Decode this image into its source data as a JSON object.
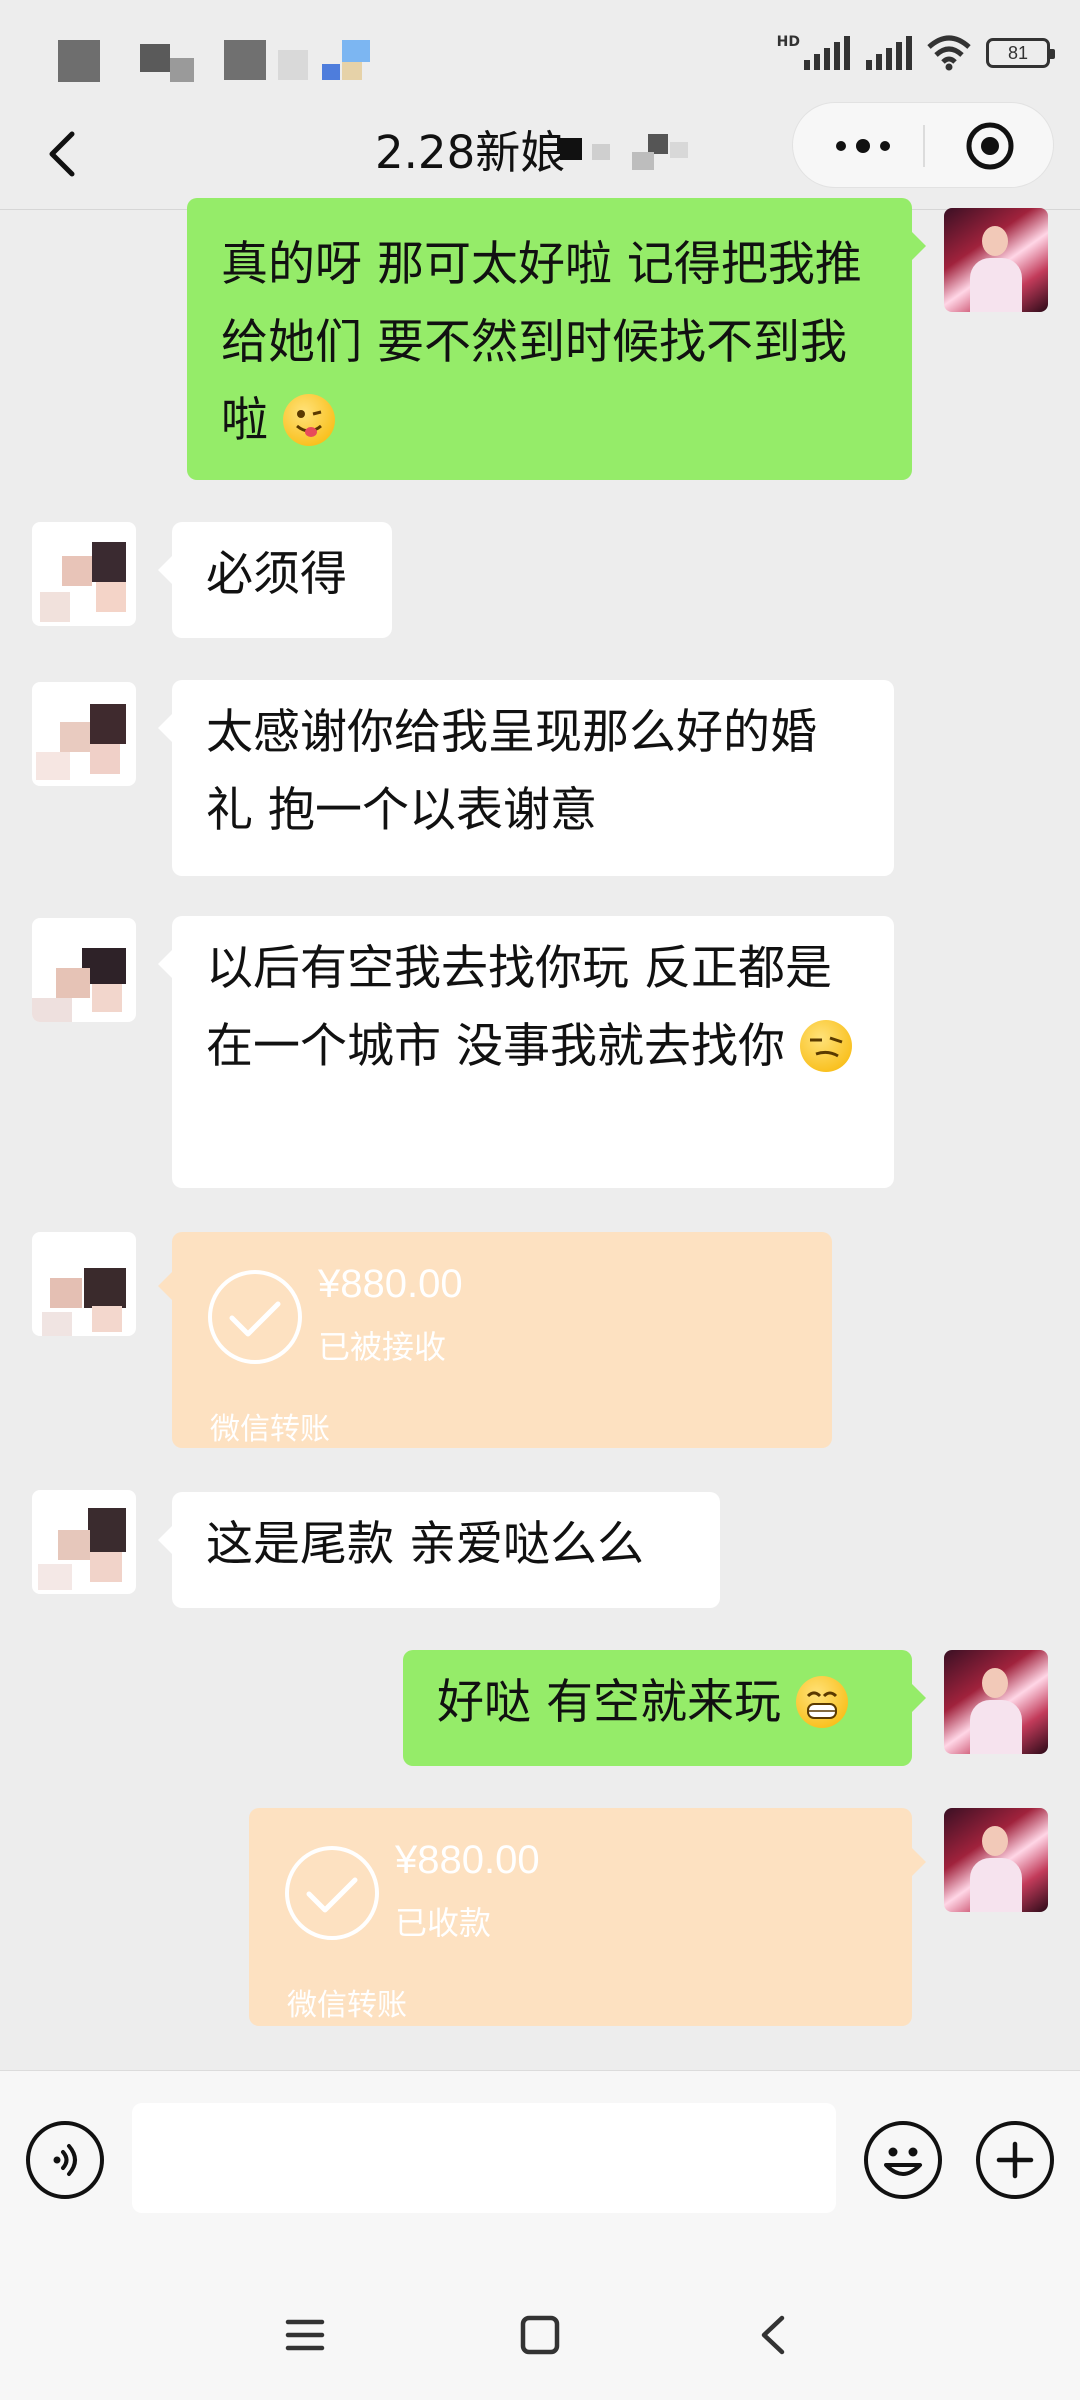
{
  "status_bar": {
    "network_label": "HD",
    "battery": "81"
  },
  "header": {
    "title": "2.28新娘"
  },
  "messages": [
    {
      "side": "right",
      "type": "text",
      "text": "真的呀 那可太好啦 记得把我推给她们 要不然到时候找不到我啦",
      "emoji": "wink-tongue"
    },
    {
      "side": "left",
      "type": "text",
      "text": "必须得"
    },
    {
      "side": "left",
      "type": "text",
      "text": "太感谢你给我呈现那么好的婚礼 抱一个以表谢意"
    },
    {
      "side": "left",
      "type": "text",
      "text": "以后有空我去找你玩 反正都是在一个城市 没事我就去找你",
      "emoji": "sly-face"
    },
    {
      "side": "left",
      "type": "transfer",
      "amount": "¥880.00",
      "status": "已被接收",
      "footer": "微信转账"
    },
    {
      "side": "left",
      "type": "text",
      "text": "这是尾款 亲爱哒么么"
    },
    {
      "side": "right",
      "type": "text",
      "text": "好哒 有空就来玩",
      "emoji": "grin"
    },
    {
      "side": "right",
      "type": "transfer",
      "amount": "¥880.00",
      "status": "已收款",
      "footer": "微信转账"
    }
  ],
  "input": {
    "value": "",
    "placeholder": ""
  },
  "colors": {
    "sent_bubble": "#95ec69",
    "received_bubble": "#ffffff",
    "transfer_card": "#fde1c1",
    "background": "#ededed"
  }
}
